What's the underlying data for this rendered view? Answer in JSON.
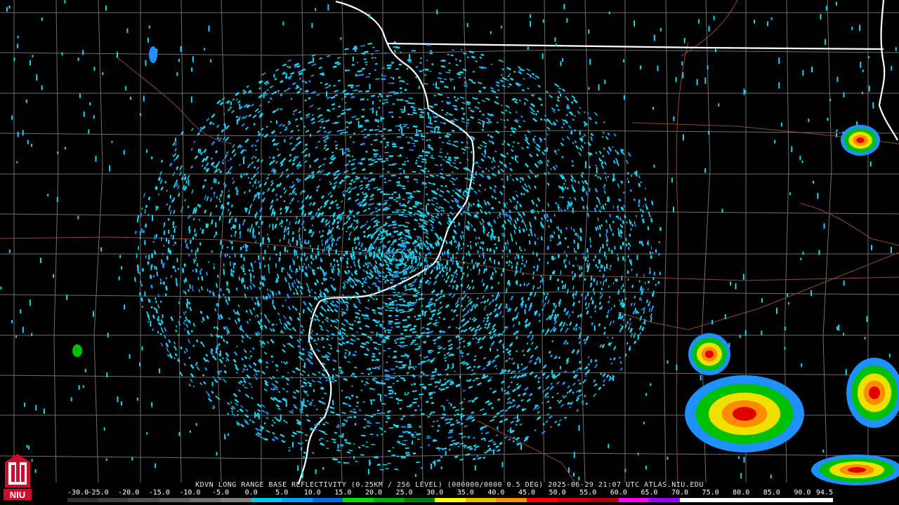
{
  "product": {
    "caption": "KDVN LONG RANGE BASE REFLECTIVITY (0.25KM / 256 LEVEL) (000000/0000 0.5 DEG) 2025-06-29 21:07 UTC   ATLAS.NIU.EDU"
  },
  "logo": {
    "text": "NIU",
    "icon": "university-tower-icon",
    "color": "#c8102e"
  },
  "colorscale": {
    "labels": [
      "-30.0",
      "-25.0",
      "-20.0",
      "-15.0",
      "-10.0",
      "-5.0",
      "0.0",
      "5.0",
      "10.0",
      "15.0",
      "20.0",
      "25.0",
      "30.0",
      "35.0",
      "40.0",
      "45.0",
      "50.0",
      "55.0",
      "60.0",
      "65.0",
      "70.0",
      "75.0",
      "80.0",
      "85.0",
      "90.0",
      "94.5"
    ],
    "colors": [
      "#303030",
      "#404040",
      "#505050",
      "#606060",
      "#707070",
      "#808080",
      "#00c8e8",
      "#00a0ff",
      "#0070e0",
      "#00e000",
      "#00b000",
      "#008000",
      "#ffff00",
      "#f0c000",
      "#ff9000",
      "#ff0000",
      "#d00000",
      "#b00000",
      "#ff00ff",
      "#a000ff",
      "#ffffff",
      "#ffffff",
      "#ffffff",
      "#ffffff",
      "#ffffff"
    ]
  },
  "colors": {
    "background": "#000000",
    "county_lines": "#6e6e6e",
    "state_lines": "#ffffff",
    "highways": "#8b4a2e",
    "echo_light": "#1ad6f0",
    "echo_mid": "#1e90ff",
    "echo_heavy": "#ffd700"
  }
}
